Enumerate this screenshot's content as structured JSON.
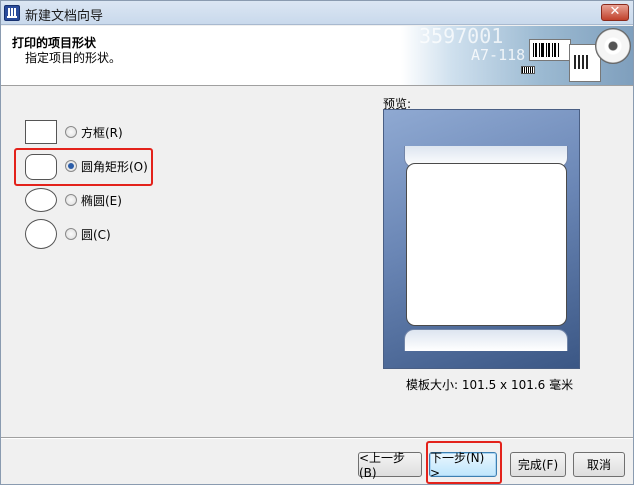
{
  "window": {
    "title": "新建文档向导",
    "close_glyph": "✕"
  },
  "header": {
    "title": "打印的项目形状",
    "subtitle": "指定项目的形状。",
    "banner_number": "3597001",
    "banner_code": "A7-118"
  },
  "shapes": [
    {
      "id": "rect",
      "label": "方框(R)",
      "checked": false
    },
    {
      "id": "rounded",
      "label": "圆角矩形(O)",
      "checked": true
    },
    {
      "id": "ellipse",
      "label": "椭圆(E)",
      "checked": false
    },
    {
      "id": "circle",
      "label": "圆(C)",
      "checked": false
    }
  ],
  "preview": {
    "label": "预览:",
    "template_size": "模板大小: 101.5 x 101.6 毫米"
  },
  "buttons": {
    "back": "<上一步(B)",
    "next": "下一步(N) >",
    "finish": "完成(F)",
    "cancel": "取消"
  },
  "colors": {
    "highlight": "#e3221b",
    "accent": "#2b5da8"
  }
}
